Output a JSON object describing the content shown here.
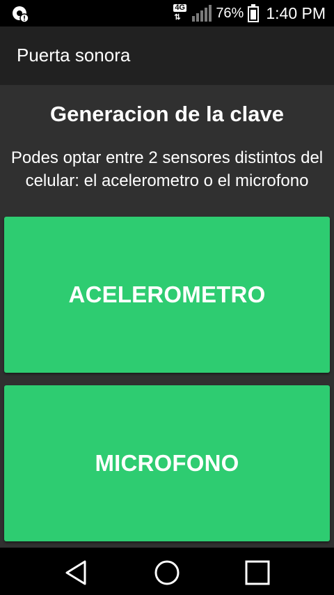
{
  "status_bar": {
    "network_type": "4G",
    "battery_percent": "76%",
    "battery_level": 0.76,
    "time": "1:40 PM",
    "icons": [
      "notification-icon",
      "network-4g-icon",
      "signal-icon",
      "battery-icon"
    ]
  },
  "toolbar": {
    "title": "Puerta sonora"
  },
  "main": {
    "heading": "Generacion de la clave",
    "description": "Podes optar entre 2 sensores distintos del celular: el acelerometro o el microfono",
    "buttons": {
      "accelerometer": "ACELEROMETRO",
      "microphone": "MICROFONO"
    },
    "accent_color": "#2ecc71"
  },
  "nav_bar": {
    "icons": [
      "back-icon",
      "home-icon",
      "recents-icon"
    ]
  }
}
